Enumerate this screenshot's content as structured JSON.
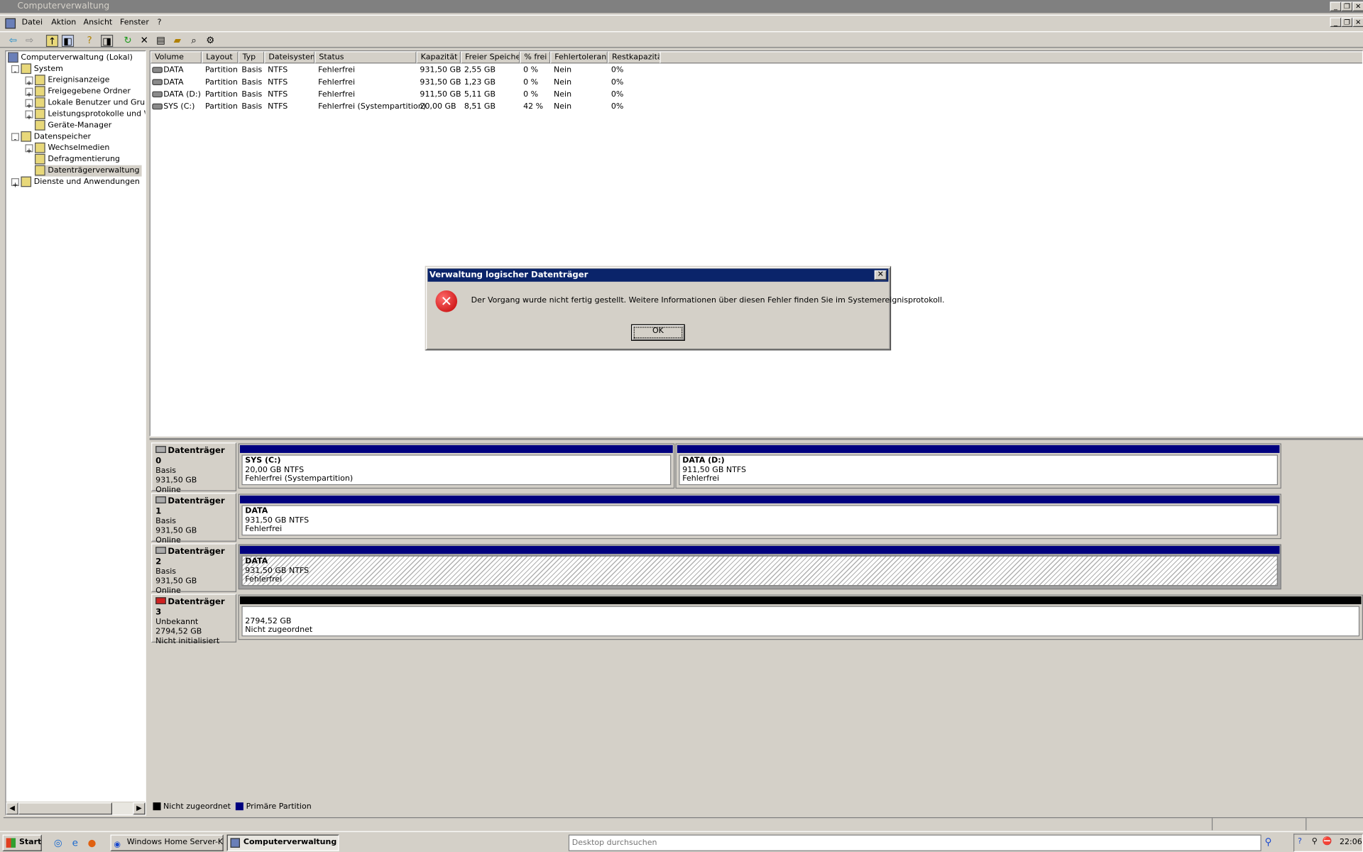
{
  "window": {
    "title": "Computerverwaltung"
  },
  "menu": [
    "Datei",
    "Aktion",
    "Ansicht",
    "Fenster",
    "?"
  ],
  "toolbar": [
    "back-icon",
    "forward-icon",
    "up-folder-icon",
    "show-hide-tree-icon",
    "help-icon",
    "action-pane-icon",
    "refresh-icon",
    "delete-icon",
    "properties-icon",
    "open-icon",
    "search-icon",
    "settings-icon"
  ],
  "tree": {
    "root": "Computerverwaltung (Lokal)",
    "items": [
      {
        "label": "System",
        "level": 1,
        "exp": "-"
      },
      {
        "label": "Ereignisanzeige",
        "level": 2,
        "exp": "+"
      },
      {
        "label": "Freigegebene Ordner",
        "level": 2,
        "exp": "+"
      },
      {
        "label": "Lokale Benutzer und Gruppen",
        "level": 2,
        "exp": "+"
      },
      {
        "label": "Leistungsprotokolle und Warnungen",
        "level": 2,
        "exp": "+"
      },
      {
        "label": "Geräte-Manager",
        "level": 2,
        "exp": ""
      },
      {
        "label": "Datenspeicher",
        "level": 1,
        "exp": "-"
      },
      {
        "label": "Wechselmedien",
        "level": 2,
        "exp": "+"
      },
      {
        "label": "Defragmentierung",
        "level": 2,
        "exp": ""
      },
      {
        "label": "Datenträgerverwaltung",
        "level": 2,
        "exp": "",
        "selected": true
      },
      {
        "label": "Dienste und Anwendungen",
        "level": 1,
        "exp": "+"
      }
    ]
  },
  "volumes": {
    "columns": [
      "Volume",
      "Layout",
      "Typ",
      "Dateisystem",
      "Status",
      "Kapazität",
      "Freier Speicher",
      "% frei",
      "Fehlertoleranz",
      "Restkapazität"
    ],
    "rows": [
      [
        "DATA",
        "Partition",
        "Basis",
        "NTFS",
        "Fehlerfrei",
        "931,50 GB",
        "2,55 GB",
        "0 %",
        "Nein",
        "0%"
      ],
      [
        "DATA",
        "Partition",
        "Basis",
        "NTFS",
        "Fehlerfrei",
        "931,50 GB",
        "1,23 GB",
        "0 %",
        "Nein",
        "0%"
      ],
      [
        "DATA (D:)",
        "Partition",
        "Basis",
        "NTFS",
        "Fehlerfrei",
        "911,50 GB",
        "5,11 GB",
        "0 %",
        "Nein",
        "0%"
      ],
      [
        "SYS (C:)",
        "Partition",
        "Basis",
        "NTFS",
        "Fehlerfrei (Systempartition)",
        "20,00 GB",
        "8,51 GB",
        "42 %",
        "Nein",
        "0%"
      ]
    ]
  },
  "disks": [
    {
      "name": "Datenträger 0",
      "type": "Basis",
      "size": "931,50 GB",
      "state": "Online",
      "parts": [
        {
          "name": "SYS  (C:)",
          "size": "20,00 GB NTFS",
          "status": "Fehlerfrei (Systempartition)"
        },
        {
          "name": "DATA  (D:)",
          "size": "911,50 GB NTFS",
          "status": "Fehlerfrei"
        }
      ]
    },
    {
      "name": "Datenträger 1",
      "type": "Basis",
      "size": "931,50 GB",
      "state": "Online",
      "parts": [
        {
          "name": "DATA",
          "size": "931,50 GB NTFS",
          "status": "Fehlerfrei"
        }
      ]
    },
    {
      "name": "Datenträger 2",
      "type": "Basis",
      "size": "931,50 GB",
      "state": "Online",
      "parts": [
        {
          "name": "DATA",
          "size": "931,50 GB NTFS",
          "status": "Fehlerfrei"
        }
      ]
    },
    {
      "name": "Datenträger 3",
      "type": "Unbekannt",
      "size": "2794,52 GB",
      "state": "Nicht initialisiert",
      "parts": [
        {
          "name": "",
          "size": "2794,52 GB",
          "status": "Nicht zugeordnet"
        }
      ]
    }
  ],
  "legend": [
    {
      "label": "Nicht zugeordnet",
      "color": "#000000"
    },
    {
      "label": "Primäre Partition",
      "color": "#00007f"
    }
  ],
  "dialog": {
    "title": "Verwaltung logischer Datenträger",
    "message": "Der Vorgang wurde nicht fertig gestellt. Weitere Informationen über diesen Fehler finden Sie im Systemereignisprotokoll.",
    "ok": "OK"
  },
  "taskbar": {
    "start": "Start",
    "tasks": [
      "Windows Home Server-K...",
      "Computerverwaltung"
    ],
    "search_placeholder": "Desktop durchsuchen",
    "clock": "22:06"
  }
}
